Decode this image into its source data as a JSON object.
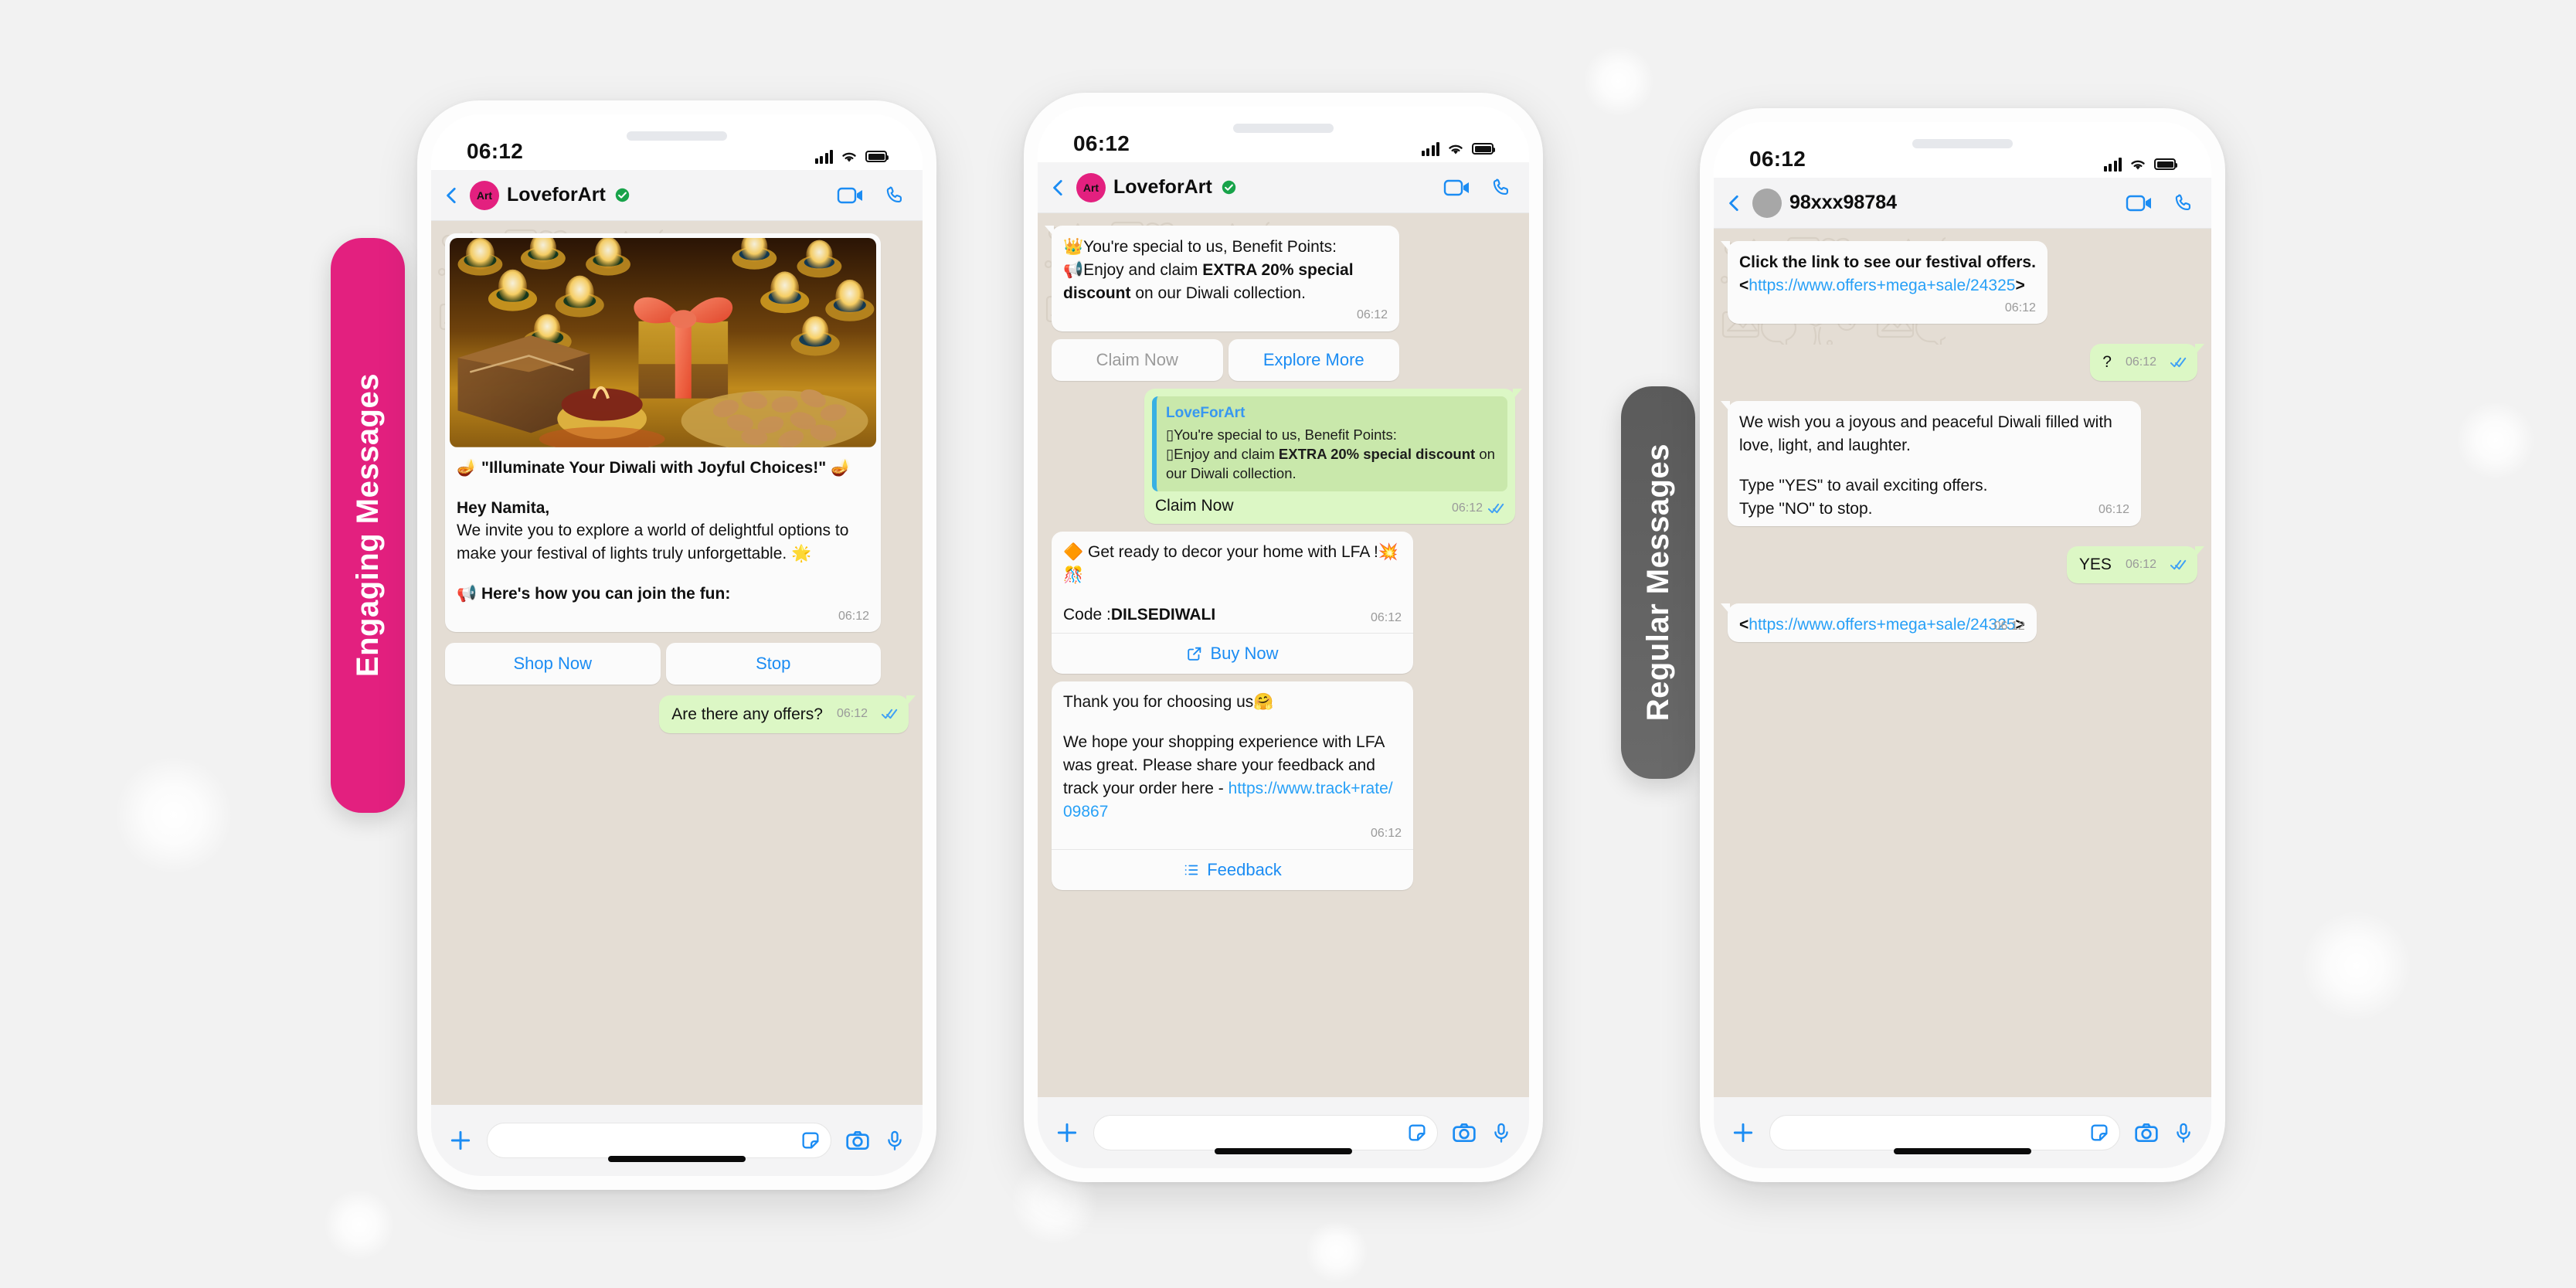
{
  "theme": {
    "page_bg": "#f2f2f2",
    "pink_accent": "#e3207f",
    "gray_accent": "#5b5b5b",
    "link_blue": "#27a0f7",
    "bubble_in": "#fbfbfb",
    "bubble_out": "#dcf7c5",
    "chat_bg": "#e4ddd4"
  },
  "tabs": {
    "engaging": "Engaging Messages",
    "regular": "Regular Messages"
  },
  "phones": [
    {
      "id": "phone-engaging-1",
      "status": {
        "time": "06:12",
        "signal": "signal-bars-icon",
        "wifi": "wifi-icon",
        "battery": "battery-icon"
      },
      "header": {
        "back": "back-chevron-icon",
        "avatar_label": "Art",
        "name": "LoveforArt",
        "verified": "verified-badge-icon",
        "video": "video-call-icon",
        "call": "phone-call-icon"
      },
      "messages": [
        {
          "kind": "card-image",
          "image_alt": "diwali-diyas-gift-nuts-photo",
          "title": "🪔 \"Illuminate Your Diwali with Joyful Choices!\" 🪔",
          "greeting": "Hey Namita,",
          "paragraph": "We invite you to explore a world of delightful options to make your festival of lights truly unforgettable. 🌟",
          "closing": "📢 Here's how you can join the fun:",
          "time": "06:12"
        },
        {
          "kind": "button-pair",
          "buttons": [
            "Shop Now",
            "Stop"
          ]
        },
        {
          "kind": "out",
          "text": "Are there any offers?",
          "time": "06:12",
          "ticks": "read-double-check-icon"
        }
      ]
    },
    {
      "id": "phone-engaging-2",
      "status": {
        "time": "06:12",
        "signal": "signal-bars-icon",
        "wifi": "wifi-icon",
        "battery": "battery-icon"
      },
      "header": {
        "back": "back-chevron-icon",
        "avatar_label": "Art",
        "name": "LoveforArt",
        "verified": "verified-badge-icon",
        "video": "video-call-icon",
        "call": "phone-call-icon"
      },
      "messages": [
        {
          "kind": "in-text",
          "line1": "👑You're special to us, Benefit Points:",
          "line2_pre": "📢Enjoy and claim ",
          "line2_bold": "EXTRA 20% special discount",
          "line2_post": " on our Diwali collection.",
          "time": "06:12"
        },
        {
          "kind": "button-pair",
          "buttons": [
            "Claim Now",
            "Explore More"
          ],
          "muted_index": 0
        },
        {
          "kind": "out-quote",
          "quote_name": "LoveForArt",
          "quote_line1": "▯You're special to us, Benefit Points:",
          "quote_line2_pre": "▯Enjoy and claim ",
          "quote_line2_bold": "EXTRA 20% special discount",
          "quote_line2_post": " on our Diwali collection.",
          "reply_text": "Claim Now",
          "time": "06:12",
          "ticks": "read-double-check-icon"
        },
        {
          "kind": "card-cta",
          "line1": "🔶 Get ready to decor your home with LFA  !💥🎊",
          "code_label": "Code : ",
          "code_value": "DILSEDIWALI",
          "time": "06:12",
          "cta_icon": "external-link-icon",
          "cta_label": "Buy Now"
        },
        {
          "kind": "card-cta",
          "line1": "Thank you for choosing us🤗",
          "line2_pre": "We hope your shopping experience with  LFA  was great. Please share your feedback and track your order here - ",
          "link": "https://www.track+rate/09867",
          "time": "06:12",
          "cta_icon": "list-icon",
          "cta_label": "Feedback"
        }
      ]
    },
    {
      "id": "phone-regular-3",
      "status": {
        "time": "06:12",
        "signal": "signal-bars-icon",
        "wifi": "wifi-icon",
        "battery": "battery-icon"
      },
      "header": {
        "back": "back-chevron-icon",
        "avatar_label": "",
        "name": "98xxx98784",
        "verified": "",
        "video": "video-call-icon",
        "call": "phone-call-icon"
      },
      "messages": [
        {
          "kind": "in-link",
          "bold_line": "Click the link to see our festival offers.",
          "prefix": "<",
          "link": "https://www.offers+mega+sale/24325",
          "suffix": ">",
          "time": "06:12"
        },
        {
          "kind": "out",
          "text": "?",
          "time": "06:12",
          "ticks": "read-double-check-icon"
        },
        {
          "kind": "in-text-plain",
          "para1": "We wish you a joyous and peaceful Diwali filled with love, light, and laughter.",
          "para2_l1": "Type \"YES\" to avail exciting offers.",
          "para2_l2": "Type \"NO\" to stop.",
          "time": "06:12"
        },
        {
          "kind": "out",
          "text": "YES",
          "time": "06:12",
          "ticks": "read-double-check-icon"
        },
        {
          "kind": "in-link-only",
          "prefix": "<",
          "link": "https://www.offers+mega+sale/24325",
          "suffix": ">",
          "time": "06:12"
        }
      ]
    }
  ],
  "composer": {
    "plus": "plus-icon",
    "placeholder": "",
    "sticker": "sticker-icon",
    "camera": "camera-icon",
    "mic": "microphone-icon"
  }
}
